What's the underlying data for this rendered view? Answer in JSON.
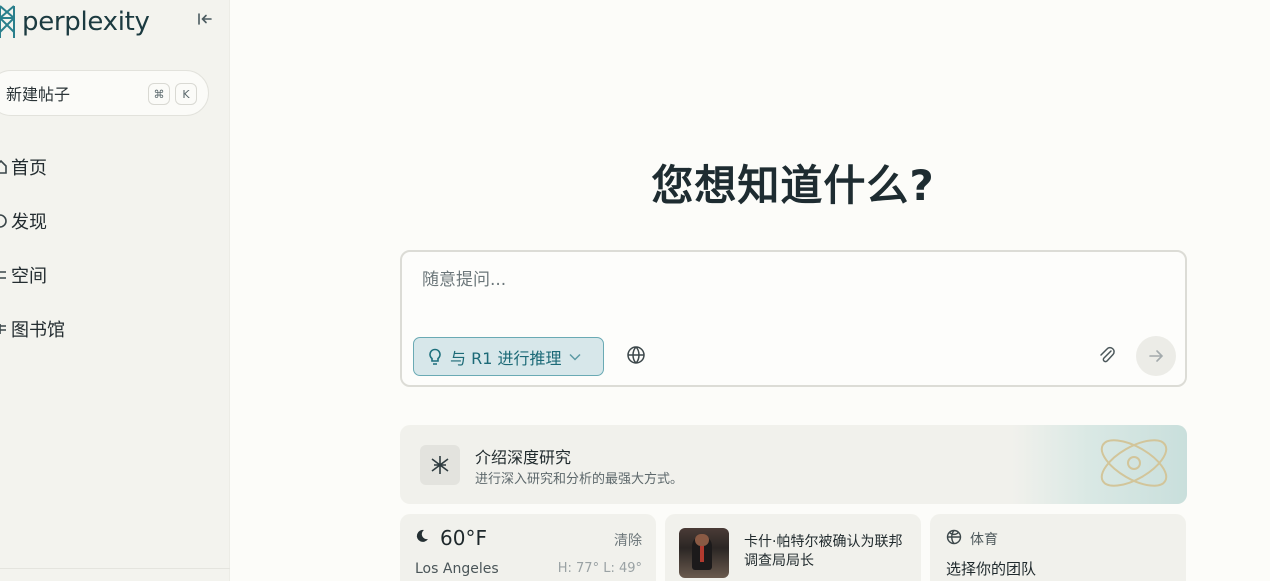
{
  "app": {
    "name": "perplexity"
  },
  "sidebar": {
    "new_thread": {
      "label": "新建帖子",
      "shortcut_keys": [
        "⌘",
        "K"
      ]
    },
    "items": [
      {
        "label": "首页",
        "icon": "home-icon"
      },
      {
        "label": "发现",
        "icon": "compass-icon"
      },
      {
        "label": "空间",
        "icon": "spaces-icon"
      },
      {
        "label": "图书馆",
        "icon": "library-icon"
      }
    ]
  },
  "main": {
    "headline": "您想知道什么?",
    "ask": {
      "placeholder": "随意提问...",
      "value": "",
      "reasoning_label": "与 R1 进行推理",
      "reasoning_active": true
    },
    "promo": {
      "title": "介绍深度研究",
      "subtitle": "进行深入研究和分析的最强大方式。"
    },
    "weather": {
      "temp": "60°F",
      "condition_icon": "moon-cloud-icon",
      "action": "清除",
      "city": "Los Angeles",
      "high_low": "H: 77° L: 49°"
    },
    "news": {
      "title": "卡什·帕特尔被确认为联邦调查局局长"
    },
    "sports": {
      "tag": "体育",
      "title": "选择你的团队"
    }
  },
  "colors": {
    "accent": "#1c6f7c",
    "accent_bg": "#d7e7ea",
    "sidebar_bg": "#f3f3ee",
    "page_bg": "#fcfcf9"
  }
}
